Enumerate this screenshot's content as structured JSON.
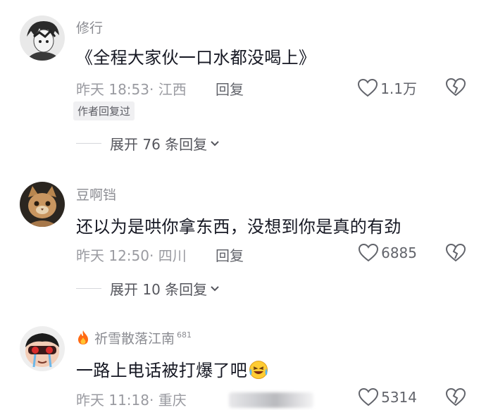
{
  "comments": [
    {
      "username": "修行",
      "content": "《全程大家伙一口水都没喝上》",
      "time": "昨天 18:53",
      "location": "· 江西",
      "reply_label": "回复",
      "likes": "1.1万",
      "author_replied": "作者回复过",
      "expand_label": "展开 76 条回复"
    },
    {
      "username": "豆啊铛",
      "content": "还以为是哄你拿东西，没想到你是真的有劲",
      "time": "昨天 12:50",
      "location": "· 四川",
      "reply_label": "回复",
      "likes": "6885",
      "expand_label": "展开 10 条回复"
    },
    {
      "username": "祈雪散落江南",
      "username_badge": "681",
      "content": "一路上电话被打爆了吧",
      "time": "昨天 11:18",
      "location": "· 重庆",
      "likes": "5314"
    }
  ],
  "icons": {
    "like": "heart-outline-icon",
    "dislike": "broken-heart-icon",
    "expand": "chevron-down-icon",
    "fire": "fire-icon",
    "emoji": "laughing-crying-emoji"
  }
}
